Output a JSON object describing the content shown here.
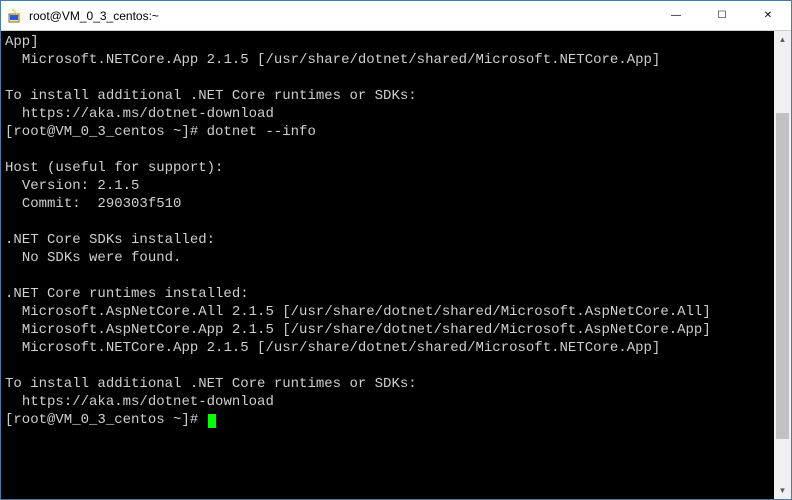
{
  "window": {
    "title": "root@VM_0_3_centos:~",
    "icon": "putty-icon"
  },
  "terminal": {
    "lines": [
      "App]",
      "  Microsoft.NETCore.App 2.1.5 [/usr/share/dotnet/shared/Microsoft.NETCore.App]",
      "",
      "To install additional .NET Core runtimes or SDKs:",
      "  https://aka.ms/dotnet-download",
      "[root@VM_0_3_centos ~]# dotnet --info",
      "",
      "Host (useful for support):",
      "  Version: 2.1.5",
      "  Commit:  290303f510",
      "",
      ".NET Core SDKs installed:",
      "  No SDKs were found.",
      "",
      ".NET Core runtimes installed:",
      "  Microsoft.AspNetCore.All 2.1.5 [/usr/share/dotnet/shared/Microsoft.AspNetCore.All]",
      "  Microsoft.AspNetCore.App 2.1.5 [/usr/share/dotnet/shared/Microsoft.AspNetCore.App]",
      "  Microsoft.NETCore.App 2.1.5 [/usr/share/dotnet/shared/Microsoft.NETCore.App]",
      "",
      "To install additional .NET Core runtimes or SDKs:",
      "  https://aka.ms/dotnet-download"
    ],
    "prompt": "[root@VM_0_3_centos ~]# "
  },
  "controls": {
    "minimize": "—",
    "maximize": "☐",
    "close": "✕"
  },
  "scrollbar": {
    "up": "▲",
    "down": "▼"
  }
}
